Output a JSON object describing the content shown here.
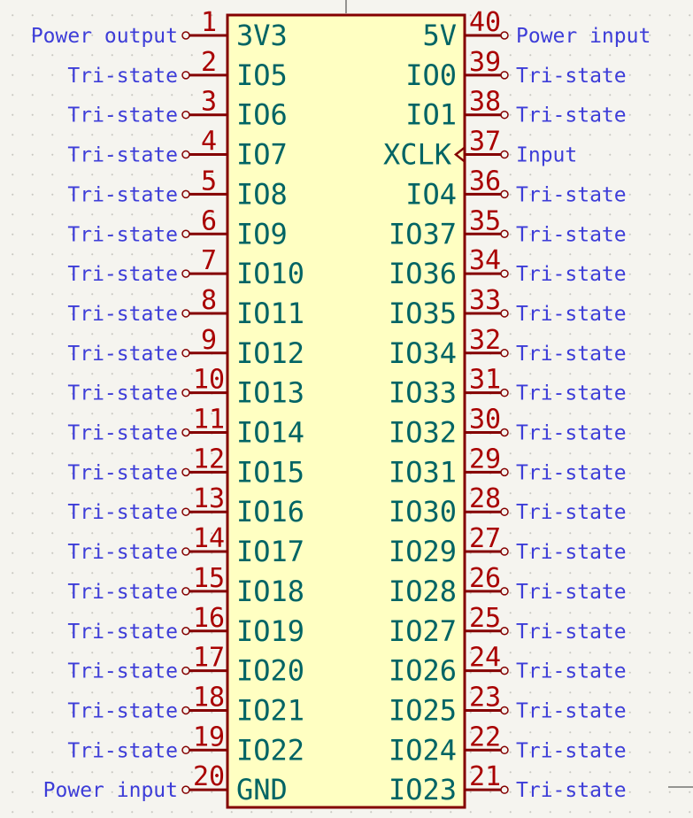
{
  "component": {
    "left_pins": [
      {
        "number": "1",
        "name": "3V3",
        "type": "Power output"
      },
      {
        "number": "2",
        "name": "IO5",
        "type": "Tri-state"
      },
      {
        "number": "3",
        "name": "IO6",
        "type": "Tri-state"
      },
      {
        "number": "4",
        "name": "IO7",
        "type": "Tri-state"
      },
      {
        "number": "5",
        "name": "IO8",
        "type": "Tri-state"
      },
      {
        "number": "6",
        "name": "IO9",
        "type": "Tri-state"
      },
      {
        "number": "7",
        "name": "IO10",
        "type": "Tri-state"
      },
      {
        "number": "8",
        "name": "IO11",
        "type": "Tri-state"
      },
      {
        "number": "9",
        "name": "IO12",
        "type": "Tri-state"
      },
      {
        "number": "10",
        "name": "IO13",
        "type": "Tri-state"
      },
      {
        "number": "11",
        "name": "IO14",
        "type": "Tri-state"
      },
      {
        "number": "12",
        "name": "IO15",
        "type": "Tri-state"
      },
      {
        "number": "13",
        "name": "IO16",
        "type": "Tri-state"
      },
      {
        "number": "14",
        "name": "IO17",
        "type": "Tri-state"
      },
      {
        "number": "15",
        "name": "IO18",
        "type": "Tri-state"
      },
      {
        "number": "16",
        "name": "IO19",
        "type": "Tri-state"
      },
      {
        "number": "17",
        "name": "IO20",
        "type": "Tri-state"
      },
      {
        "number": "18",
        "name": "IO21",
        "type": "Tri-state"
      },
      {
        "number": "19",
        "name": "IO22",
        "type": "Tri-state"
      },
      {
        "number": "20",
        "name": "GND",
        "type": "Power input"
      }
    ],
    "right_pins": [
      {
        "number": "40",
        "name": "5V",
        "type": "Power input"
      },
      {
        "number": "39",
        "name": "IO0",
        "type": "Tri-state"
      },
      {
        "number": "38",
        "name": "IO1",
        "type": "Tri-state"
      },
      {
        "number": "37",
        "name": "XCLK",
        "type": "Input",
        "clock": true
      },
      {
        "number": "36",
        "name": "IO4",
        "type": "Tri-state"
      },
      {
        "number": "35",
        "name": "IO37",
        "type": "Tri-state"
      },
      {
        "number": "34",
        "name": "IO36",
        "type": "Tri-state"
      },
      {
        "number": "33",
        "name": "IO35",
        "type": "Tri-state"
      },
      {
        "number": "32",
        "name": "IO34",
        "type": "Tri-state"
      },
      {
        "number": "31",
        "name": "IO33",
        "type": "Tri-state"
      },
      {
        "number": "30",
        "name": "IO32",
        "type": "Tri-state"
      },
      {
        "number": "29",
        "name": "IO31",
        "type": "Tri-state"
      },
      {
        "number": "28",
        "name": "IO30",
        "type": "Tri-state"
      },
      {
        "number": "27",
        "name": "IO29",
        "type": "Tri-state"
      },
      {
        "number": "26",
        "name": "IO28",
        "type": "Tri-state"
      },
      {
        "number": "25",
        "name": "IO27",
        "type": "Tri-state"
      },
      {
        "number": "24",
        "name": "IO26",
        "type": "Tri-state"
      },
      {
        "number": "23",
        "name": "IO25",
        "type": "Tri-state"
      },
      {
        "number": "22",
        "name": "IO24",
        "type": "Tri-state"
      },
      {
        "number": "21",
        "name": "IO23",
        "type": "Tri-state"
      }
    ]
  },
  "colors": {
    "body_fill": "#ffffc2",
    "outline": "#840000",
    "pin_number": "#a90000",
    "pin_name": "#006464",
    "pin_type": "#3d3dd8",
    "background": "#f5f4ef"
  }
}
